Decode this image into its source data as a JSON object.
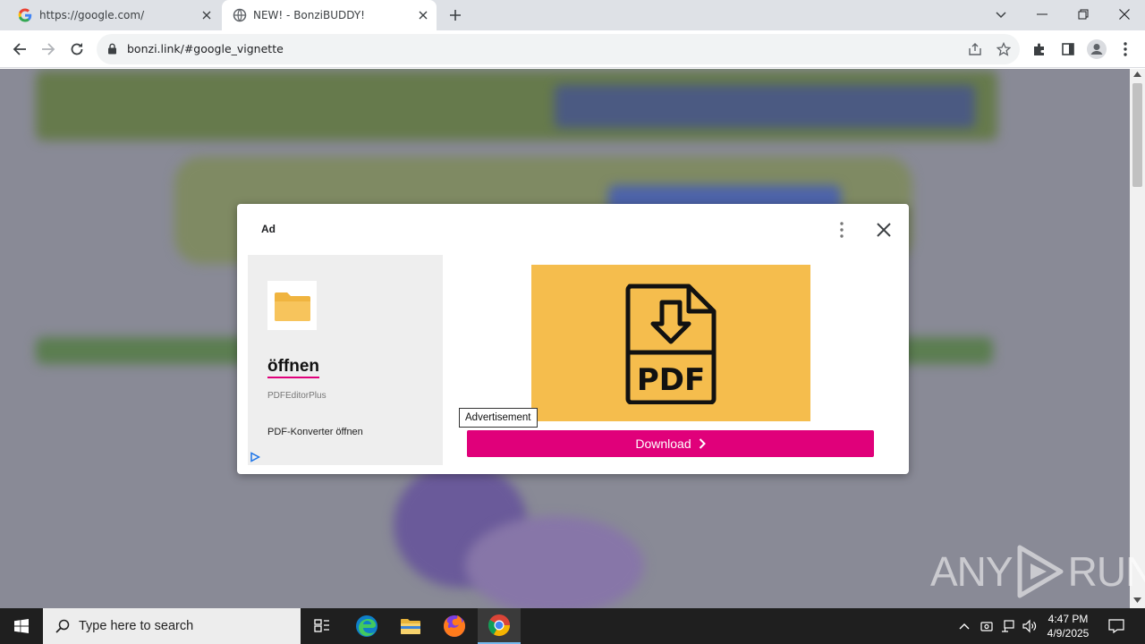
{
  "browser": {
    "tabs": [
      {
        "title": "https://google.com/"
      },
      {
        "title": "NEW! - BonziBUDDY!"
      }
    ],
    "url": "bonzi.link/#google_vignette"
  },
  "ad": {
    "label": "Ad",
    "headline": "öffnen",
    "advertiser": "PDFEditorPlus",
    "description": "PDF-Konverter öffnen",
    "banner_text": "PDF",
    "tooltip": "Advertisement",
    "button_label": "Download",
    "accent": "#e0007a",
    "banner_color": "#f5bd4d"
  },
  "taskbar": {
    "search_placeholder": "Type here to search",
    "time": "4:47 PM",
    "date": "4/9/2025"
  },
  "watermark": {
    "left": "ANY",
    "right": "RUN"
  }
}
